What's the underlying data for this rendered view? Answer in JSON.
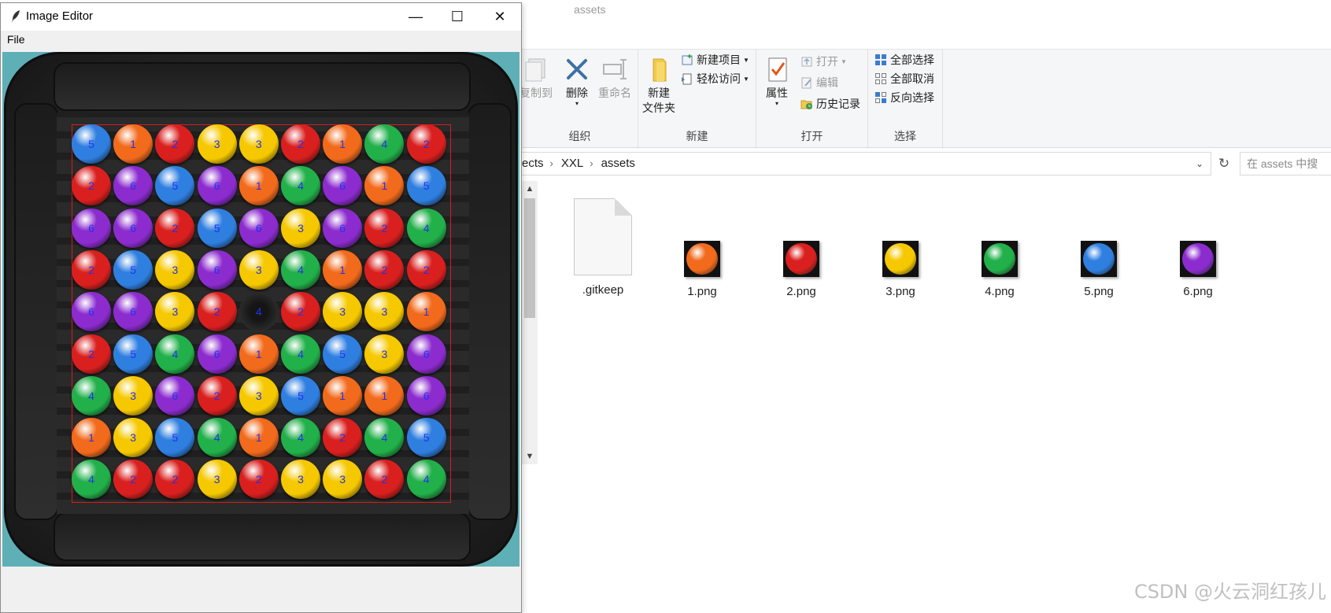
{
  "explorer": {
    "title": "assets",
    "ribbon": {
      "organize": {
        "label": "组织",
        "copy_to": "复制到",
        "delete": "删除",
        "rename": "重命名"
      },
      "new": {
        "label": "新建",
        "new_folder_line1": "新建",
        "new_folder_line2": "文件夹",
        "new_item": "新建项目",
        "easy_access": "轻松访问"
      },
      "open": {
        "label": "打开",
        "properties": "属性",
        "open": "打开",
        "edit": "编辑",
        "history": "历史记录"
      },
      "select": {
        "label": "选择",
        "select_all": "全部选择",
        "select_none": "全部取消",
        "invert": "反向选择"
      }
    },
    "address": {
      "crumbs": [
        "ects",
        "XXL",
        "assets"
      ]
    },
    "search_placeholder": "在 assets 中搜",
    "files": [
      {
        "name": ".gitkeep",
        "kind": "doc"
      },
      {
        "name": "1.png",
        "kind": "ball",
        "color": "#f26a1c"
      },
      {
        "name": "2.png",
        "kind": "ball",
        "color": "#d9201f"
      },
      {
        "name": "3.png",
        "kind": "ball",
        "color": "#f5c800"
      },
      {
        "name": "4.png",
        "kind": "ball",
        "color": "#22b04a"
      },
      {
        "name": "5.png",
        "kind": "ball",
        "color": "#2f7fe0"
      },
      {
        "name": "6.png",
        "kind": "ball",
        "color": "#8c2ccf"
      }
    ]
  },
  "watermark": "CSDN @火云洞红孩儿",
  "editor": {
    "title": "Image Editor",
    "menu": {
      "file": "File"
    },
    "window_buttons": {
      "minimize": "—",
      "maximize": "☐",
      "close": "✕"
    },
    "ball_colors": {
      "1": "#f26a1c",
      "2": "#d9201f",
      "3": "#f5c800",
      "4": "#22b04a",
      "5": "#2f7fe0",
      "6": "#8c2ccf"
    },
    "grid": [
      [
        5,
        1,
        2,
        3,
        3,
        2,
        1,
        4,
        2
      ],
      [
        2,
        6,
        5,
        6,
        1,
        4,
        6,
        1,
        5
      ],
      [
        6,
        6,
        2,
        5,
        6,
        3,
        6,
        2,
        4
      ],
      [
        2,
        5,
        3,
        6,
        3,
        4,
        1,
        2,
        2
      ],
      [
        6,
        6,
        3,
        2,
        0,
        2,
        3,
        3,
        1
      ],
      [
        2,
        5,
        4,
        6,
        1,
        4,
        5,
        3,
        6
      ],
      [
        4,
        3,
        6,
        2,
        3,
        5,
        1,
        1,
        6
      ],
      [
        1,
        3,
        5,
        4,
        1,
        4,
        2,
        4,
        5
      ],
      [
        4,
        2,
        2,
        3,
        2,
        3,
        3,
        2,
        4
      ]
    ],
    "empty_cell_label": "4"
  }
}
